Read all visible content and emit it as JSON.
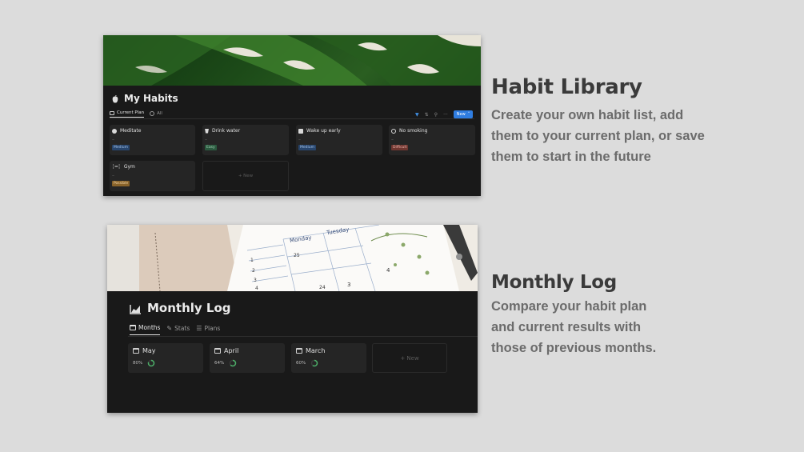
{
  "habits_panel": {
    "title": "My Habits",
    "tabs": [
      {
        "label": "Current Plan"
      },
      {
        "label": "All"
      }
    ],
    "new_button": "New",
    "new_card": "+ New",
    "habits": [
      {
        "name": "Meditate",
        "value": "–",
        "level": "Medium",
        "level_color": "#28456c",
        "level_text": "#a5c4ea"
      },
      {
        "name": "Drink water",
        "value": "–",
        "level": "Easy",
        "level_color": "#2b593f",
        "level_text": "#a6d5b8"
      },
      {
        "name": "Wake up early",
        "value": "–",
        "level": "Medium",
        "level_color": "#28456c",
        "level_text": "#a5c4ea"
      },
      {
        "name": "No smoking",
        "value": "–",
        "level": "Difficult",
        "level_color": "#6e3630",
        "level_text": "#efb3ab"
      },
      {
        "name": "Gym",
        "value": "–",
        "level": "Possible",
        "level_color": "#89632a",
        "level_text": "#f3d6a8"
      }
    ]
  },
  "monthly_panel": {
    "title": "Monthly Log",
    "tabs": [
      {
        "label": "Months"
      },
      {
        "label": "Stats"
      },
      {
        "label": "Plans"
      }
    ],
    "new_card": "+ New",
    "months": [
      {
        "name": "May",
        "percent": "80%",
        "progress": 0.8
      },
      {
        "name": "April",
        "percent": "64%",
        "progress": 0.64
      },
      {
        "name": "March",
        "percent": "60%",
        "progress": 0.6
      }
    ],
    "calendar": {
      "day1": "Monday",
      "day2": "Tuesday",
      "nums": [
        "1",
        "2",
        "3",
        "4",
        "25",
        "24",
        "3",
        "4"
      ]
    }
  },
  "section1": {
    "heading": "Habit Library",
    "lines": [
      "Create your own habit list, add",
      "them to your current plan, or save",
      "them to start in the future"
    ]
  },
  "section2": {
    "heading": "Monthly Log",
    "lines": [
      "Compare your habit plan",
      "and current results with",
      "those of previous months."
    ]
  }
}
